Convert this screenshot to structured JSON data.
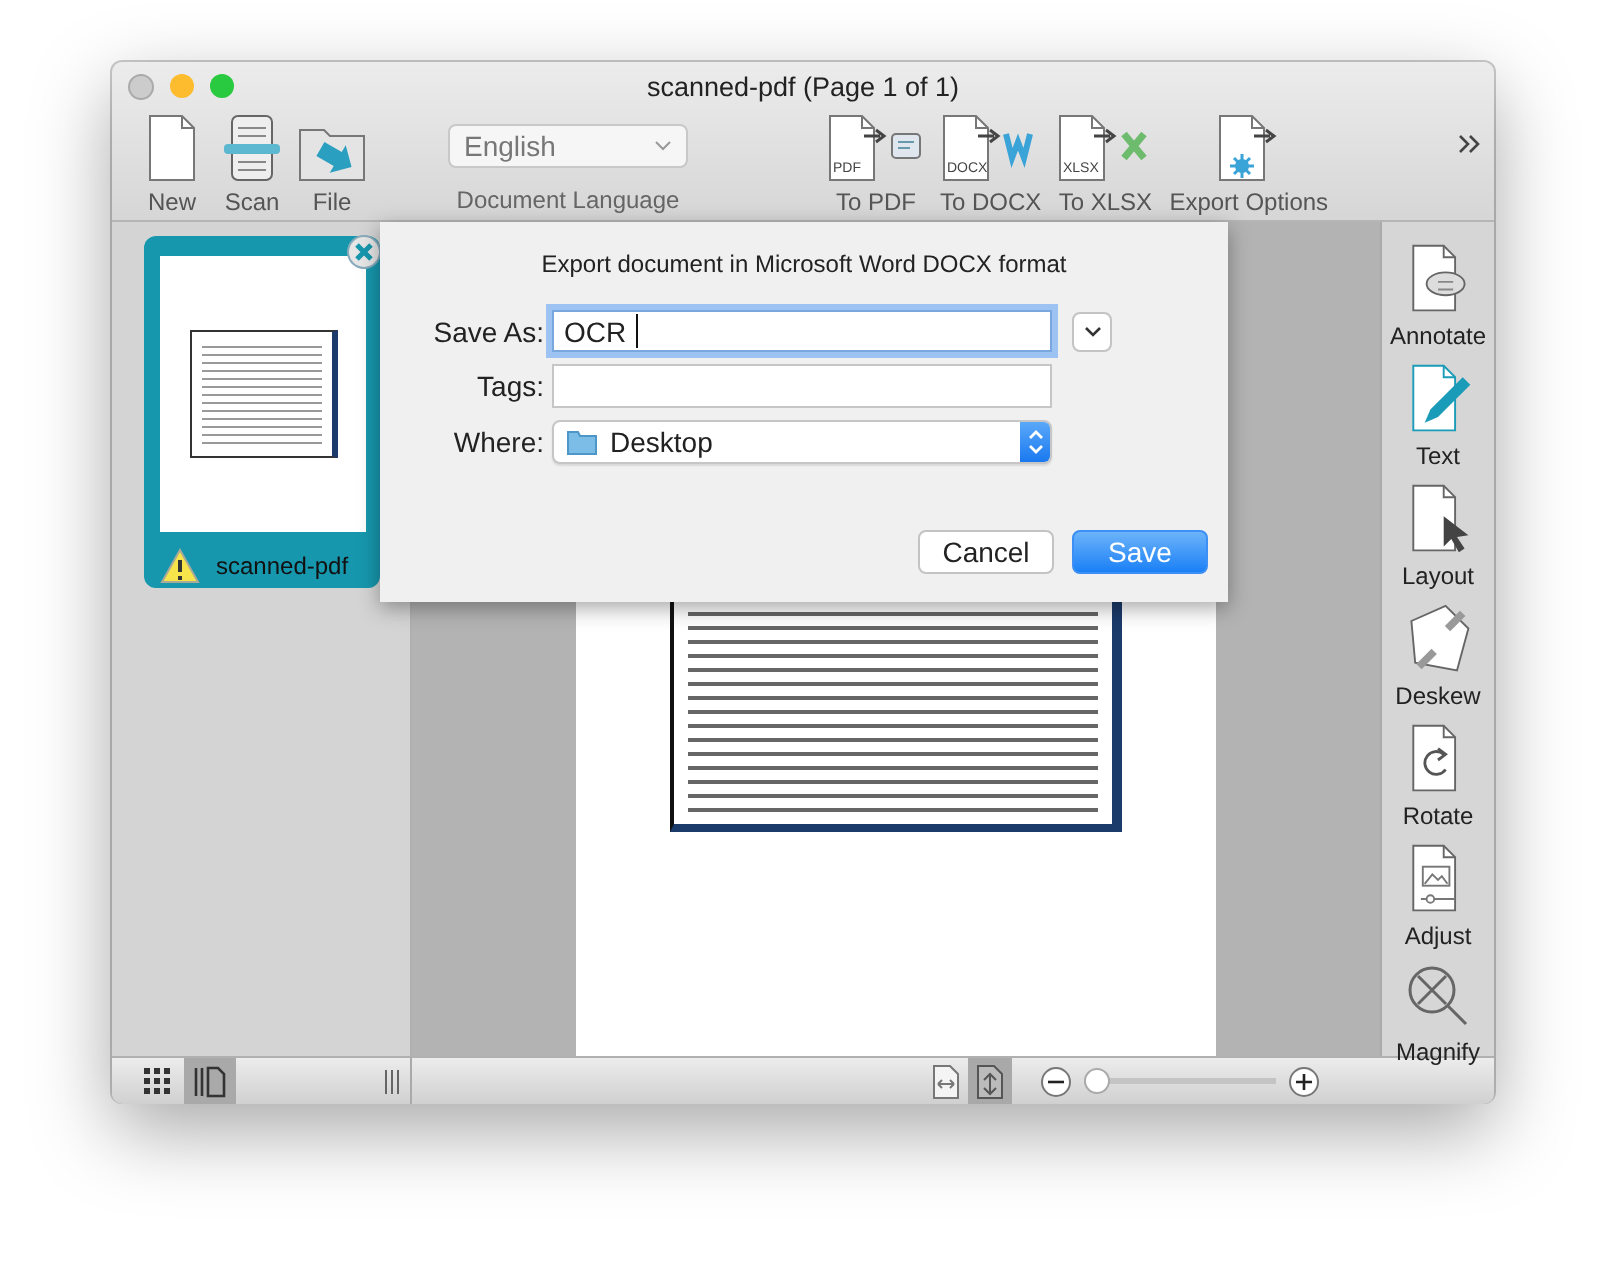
{
  "window": {
    "title": "scanned-pdf (Page 1 of 1)"
  },
  "toolbar": {
    "actions": [
      {
        "label": "New",
        "kind": "new"
      },
      {
        "label": "Scan",
        "kind": "scan"
      },
      {
        "label": "File",
        "kind": "file"
      }
    ],
    "language": {
      "value": "English",
      "label": "Document Language"
    },
    "exports": [
      {
        "label": "To PDF",
        "kind": "pdf",
        "badge": "PDF"
      },
      {
        "label": "To DOCX",
        "kind": "docx",
        "badge": "DOCX"
      },
      {
        "label": "To XLSX",
        "kind": "xlsx",
        "badge": "XLSX"
      },
      {
        "label": "Export Options",
        "kind": "options"
      }
    ]
  },
  "sidebar": {
    "pages": [
      {
        "name": "scanned-pdf",
        "selected": true,
        "warning": true
      }
    ]
  },
  "dialog": {
    "title": "Export document in Microsoft Word DOCX format",
    "fields": [
      {
        "label": "Save As:",
        "kind": "text",
        "value": "OCR",
        "focused": true
      },
      {
        "label": "Tags:",
        "kind": "text",
        "focused": false
      },
      {
        "label": "Where:",
        "kind": "popup",
        "value": "Desktop"
      }
    ],
    "buttons": [
      {
        "label": "Cancel",
        "default": false
      },
      {
        "label": "Save",
        "default": true
      }
    ]
  },
  "tools": [
    {
      "label": "Annotate",
      "kind": "annotate",
      "selected": false
    },
    {
      "label": "Text",
      "kind": "text",
      "selected": true
    },
    {
      "label": "Layout",
      "kind": "layout",
      "selected": false
    },
    {
      "label": "Deskew",
      "kind": "deskew",
      "selected": false
    },
    {
      "label": "Rotate",
      "kind": "rotate",
      "selected": false
    },
    {
      "label": "Adjust",
      "kind": "adjust",
      "selected": false
    },
    {
      "label": "Magnify",
      "kind": "magnify",
      "selected": false
    }
  ],
  "bottom_bar": {
    "view_modes": [
      {
        "kind": "grid",
        "selected": false
      },
      {
        "kind": "pages",
        "selected": true
      }
    ],
    "page_modes": [
      {
        "kind": "fit-width",
        "selected": false
      },
      {
        "kind": "fit-page",
        "selected": true
      }
    ],
    "zoom": {
      "level": 0
    }
  }
}
